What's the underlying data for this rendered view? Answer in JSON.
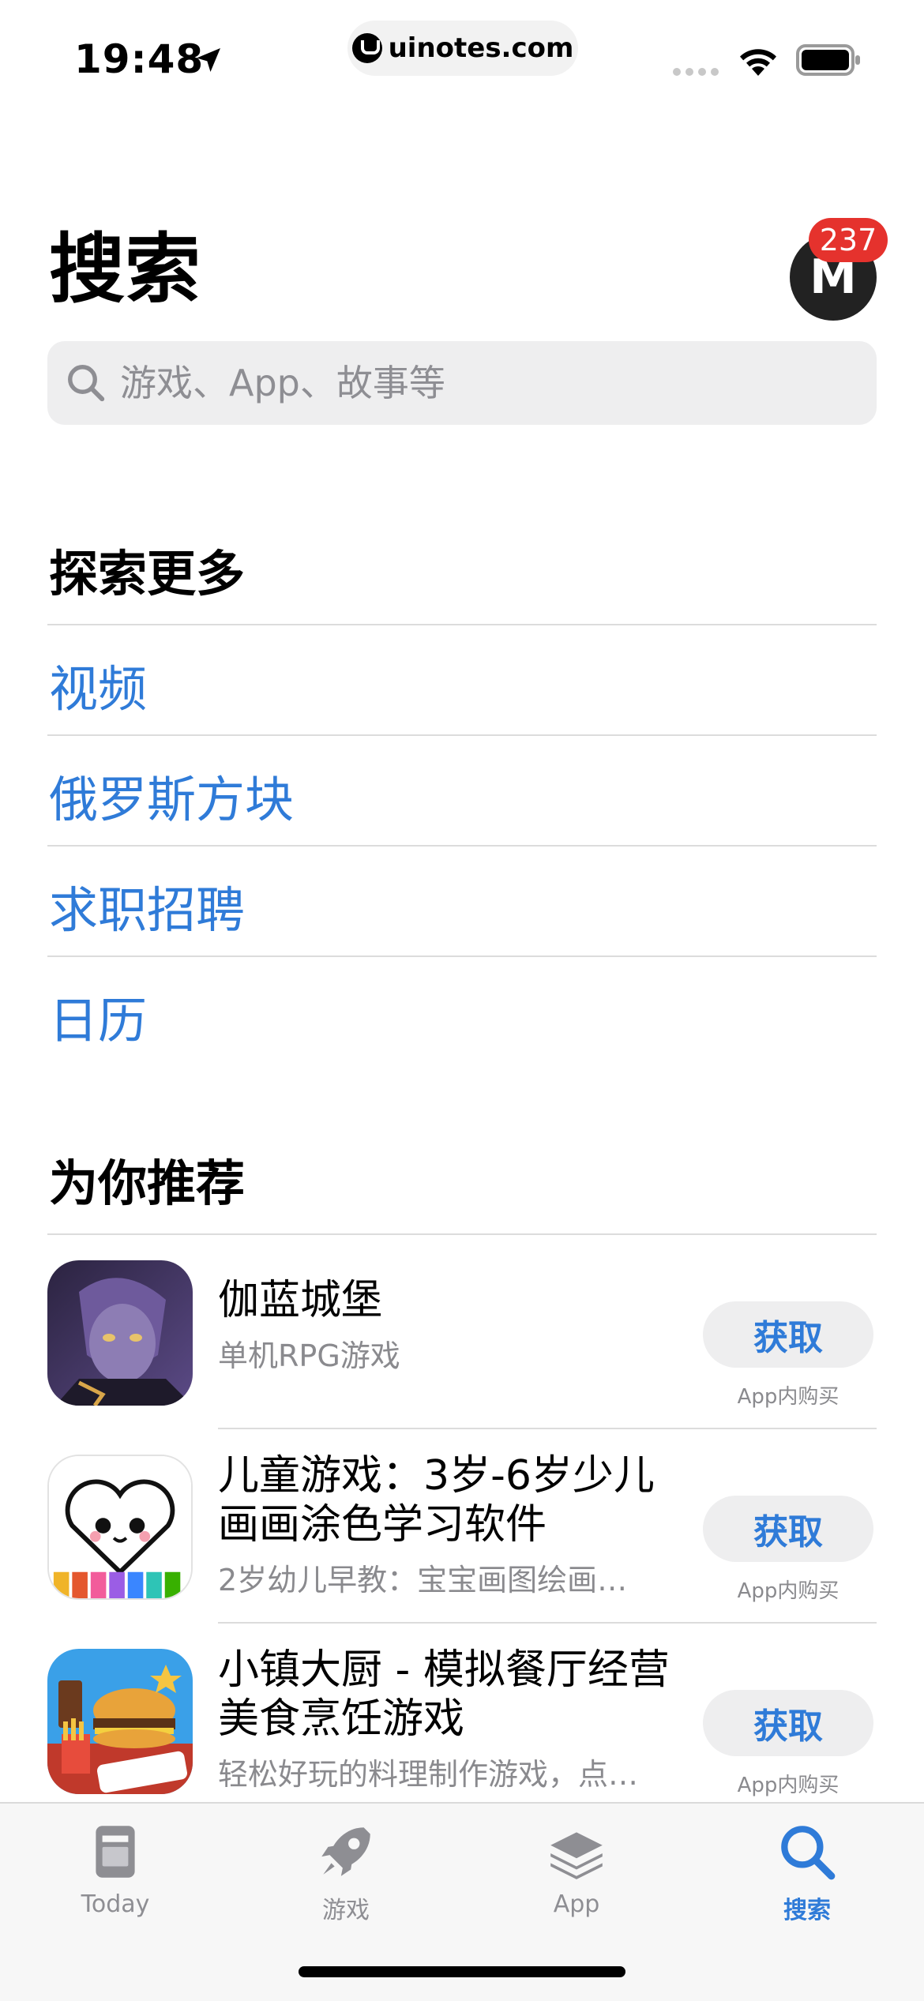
{
  "status_bar": {
    "time": "19:48",
    "url": "uinotes.com"
  },
  "header": {
    "title": "搜索",
    "avatar_letter": "M",
    "badge_count": "237"
  },
  "search": {
    "placeholder": "游戏、App、故事等"
  },
  "explore": {
    "title": "探索更多",
    "items": [
      "视频",
      "俄罗斯方块",
      "求职招聘",
      "日历"
    ]
  },
  "recommended": {
    "title": "为你推荐",
    "apps": [
      {
        "name": "伽蓝城堡",
        "subtitle": "单机RPG游戏",
        "button": "获取",
        "iap": "App内购买"
      },
      {
        "name": "儿童游戏：3岁-6岁少儿画画涂色学习软件",
        "subtitle": "2岁幼儿早教：宝宝画图绘画…",
        "button": "获取",
        "iap": "App内购买"
      },
      {
        "name": "小镇大厨 - 模拟餐厅经营美食烹饪游戏",
        "subtitle": "轻松好玩的料理制作游戏，点…",
        "button": "获取",
        "iap": "App内购买"
      }
    ]
  },
  "tabbar": {
    "tabs": [
      {
        "label": "Today",
        "icon": "today-icon"
      },
      {
        "label": "游戏",
        "icon": "rocket-icon"
      },
      {
        "label": "App",
        "icon": "apps-stack-icon"
      },
      {
        "label": "搜索",
        "icon": "search-icon",
        "active": true
      }
    ]
  },
  "colors": {
    "accent": "#2f7bd8",
    "badge": "#e5322d",
    "secondary_text": "#8a8a8e"
  }
}
